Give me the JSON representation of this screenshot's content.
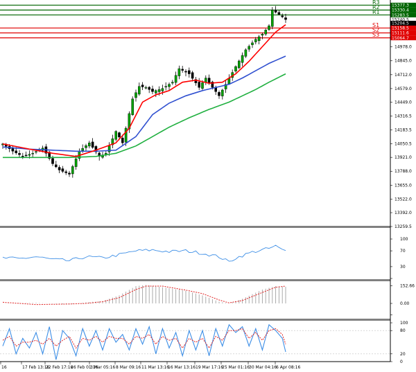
{
  "colors": {
    "background": "#ffffff",
    "axis": "#000000",
    "bull_candle": "#00a000",
    "bear_candle": "#000000",
    "ma_fast": "#ff0000",
    "ma_mid": "#3050d0",
    "ma_slow": "#20b040",
    "resistance": "#006400",
    "support": "#e00000",
    "rsi": "#3c8ee6",
    "macd_hist": "#a0a0a0",
    "macd_signal": "#e02020",
    "stoch_main": "#3c8ee6",
    "stoch_signal": "#e02020",
    "current_price_box": "#000000"
  },
  "chart_data": [
    {
      "type": "candlestick",
      "title": "",
      "ylim": [
        13259.5,
        15400
      ],
      "y_ticks": [
        "14978.0",
        "14845.0",
        "14712.0",
        "14579.0",
        "14449.0",
        "14316.5",
        "14183.5",
        "14050.5",
        "13921.0",
        "13788.0",
        "13655.0",
        "13522.0",
        "13392.0",
        "13259.5"
      ],
      "x_labels": [
        "16",
        "17 Feb 13:16",
        "22 Feb 17:16",
        "26 Feb 01:16",
        "3 Mar 05:16",
        "8 Mar 09:16",
        "11 Mar 13:16",
        "16 Mar 13:16",
        "19 Mar 17:16",
        "25 Mar 01:16",
        "30 Mar 04:16",
        "6 Apr 08:16"
      ],
      "levels": [
        {
          "name": "R3",
          "value": 15377.3,
          "label": "15377.3",
          "kind": "resistance"
        },
        {
          "name": "R2",
          "value": 15330.4,
          "label": "15330.4",
          "kind": "resistance"
        },
        {
          "name": "R1",
          "value": 15283.5,
          "label": "15283.5",
          "kind": "resistance"
        },
        {
          "name": "",
          "value": 15240.5,
          "label": "15240.5",
          "kind": "plain"
        },
        {
          "name": "",
          "value": 15204.5,
          "label": "15204.5",
          "kind": "current"
        },
        {
          "name": "S1",
          "value": 15158.5,
          "label": "15158.5",
          "kind": "support"
        },
        {
          "name": "S2",
          "value": 15111.6,
          "label": "15111.6",
          "kind": "support"
        },
        {
          "name": "S3",
          "value": 15064.7,
          "label": "15064.7",
          "kind": "support"
        }
      ],
      "close_anchors": [
        [
          0,
          14050
        ],
        [
          3,
          13980
        ],
        [
          6,
          13930
        ],
        [
          9,
          13960
        ],
        [
          12,
          14010
        ],
        [
          15,
          13860
        ],
        [
          17,
          13800
        ],
        [
          20,
          13760
        ],
        [
          23,
          13980
        ],
        [
          26,
          14060
        ],
        [
          29,
          13930
        ],
        [
          31,
          13960
        ],
        [
          34,
          14170
        ],
        [
          36,
          14060
        ],
        [
          39,
          14480
        ],
        [
          41,
          14600
        ],
        [
          43,
          14590
        ],
        [
          45,
          14550
        ],
        [
          48,
          14580
        ],
        [
          51,
          14640
        ],
        [
          53,
          14770
        ],
        [
          56,
          14720
        ],
        [
          59,
          14590
        ],
        [
          61,
          14680
        ],
        [
          63,
          14590
        ],
        [
          65,
          14510
        ],
        [
          67,
          14620
        ],
        [
          70,
          14790
        ],
        [
          73,
          14950
        ],
        [
          76,
          15050
        ],
        [
          78,
          15100
        ],
        [
          80,
          15180
        ],
        [
          81,
          15330
        ],
        [
          83,
          15290
        ],
        [
          85,
          15240
        ]
      ],
      "ma_fast_anchors": [
        [
          0,
          14050
        ],
        [
          8,
          14000
        ],
        [
          15,
          13960
        ],
        [
          22,
          13930
        ],
        [
          28,
          13990
        ],
        [
          34,
          14060
        ],
        [
          38,
          14200
        ],
        [
          42,
          14450
        ],
        [
          46,
          14520
        ],
        [
          50,
          14560
        ],
        [
          54,
          14640
        ],
        [
          58,
          14660
        ],
        [
          62,
          14630
        ],
        [
          66,
          14640
        ],
        [
          70,
          14720
        ],
        [
          74,
          14840
        ],
        [
          78,
          14980
        ],
        [
          82,
          15120
        ],
        [
          85,
          15190
        ]
      ],
      "ma_mid_anchors": [
        [
          0,
          14020
        ],
        [
          8,
          14000
        ],
        [
          15,
          13990
        ],
        [
          22,
          13980
        ],
        [
          28,
          13980
        ],
        [
          34,
          13990
        ],
        [
          40,
          14120
        ],
        [
          45,
          14330
        ],
        [
          50,
          14440
        ],
        [
          55,
          14510
        ],
        [
          60,
          14560
        ],
        [
          64,
          14590
        ],
        [
          68,
          14620
        ],
        [
          72,
          14680
        ],
        [
          76,
          14750
        ],
        [
          80,
          14820
        ],
        [
          85,
          14890
        ]
      ],
      "ma_slow_anchors": [
        [
          0,
          13920
        ],
        [
          10,
          13920
        ],
        [
          20,
          13920
        ],
        [
          28,
          13930
        ],
        [
          34,
          13960
        ],
        [
          40,
          14030
        ],
        [
          45,
          14120
        ],
        [
          50,
          14210
        ],
        [
          56,
          14300
        ],
        [
          62,
          14380
        ],
        [
          68,
          14450
        ],
        [
          72,
          14510
        ],
        [
          76,
          14570
        ],
        [
          80,
          14640
        ],
        [
          85,
          14720
        ]
      ]
    },
    {
      "type": "line",
      "title": "",
      "y_ticks": [
        "100",
        "70",
        "30",
        "0"
      ],
      "ylim": [
        0,
        100
      ],
      "rsi_anchors": [
        [
          0,
          52
        ],
        [
          5,
          50
        ],
        [
          10,
          55
        ],
        [
          15,
          48
        ],
        [
          20,
          45
        ],
        [
          25,
          55
        ],
        [
          30,
          52
        ],
        [
          35,
          60
        ],
        [
          40,
          70
        ],
        [
          45,
          72
        ],
        [
          50,
          68
        ],
        [
          55,
          70
        ],
        [
          60,
          64
        ],
        [
          65,
          55
        ],
        [
          68,
          42
        ],
        [
          70,
          52
        ],
        [
          75,
          67
        ],
        [
          80,
          76
        ],
        [
          82,
          82
        ],
        [
          84,
          72
        ],
        [
          85,
          70
        ]
      ]
    },
    {
      "type": "bar",
      "title": "",
      "y_ticks": [
        "152.66",
        "0.00",
        "-100"
      ],
      "ylim": [
        -120,
        180
      ],
      "hist_anchors": [
        [
          0,
          0
        ],
        [
          10,
          5
        ],
        [
          20,
          -10
        ],
        [
          25,
          10
        ],
        [
          30,
          20
        ],
        [
          35,
          70
        ],
        [
          40,
          150
        ],
        [
          43,
          160
        ],
        [
          48,
          140
        ],
        [
          55,
          110
        ],
        [
          60,
          70
        ],
        [
          65,
          15
        ],
        [
          68,
          0
        ],
        [
          72,
          40
        ],
        [
          78,
          120
        ],
        [
          82,
          150
        ],
        [
          85,
          145
        ]
      ],
      "signal_anchors": [
        [
          0,
          10
        ],
        [
          10,
          -10
        ],
        [
          20,
          -5
        ],
        [
          25,
          0
        ],
        [
          30,
          15
        ],
        [
          35,
          50
        ],
        [
          40,
          120
        ],
        [
          43,
          150
        ],
        [
          48,
          150
        ],
        [
          55,
          115
        ],
        [
          60,
          85
        ],
        [
          65,
          30
        ],
        [
          68,
          5
        ],
        [
          72,
          25
        ],
        [
          78,
          95
        ],
        [
          82,
          140
        ],
        [
          85,
          150
        ]
      ]
    },
    {
      "type": "line",
      "title": "",
      "y_ticks": [
        "100",
        "80",
        "20",
        "0"
      ],
      "ylim": [
        0,
        100
      ],
      "stoch_main_anchors": [
        [
          0,
          40
        ],
        [
          2,
          85
        ],
        [
          4,
          20
        ],
        [
          6,
          60
        ],
        [
          8,
          35
        ],
        [
          10,
          75
        ],
        [
          12,
          20
        ],
        [
          14,
          90
        ],
        [
          16,
          5
        ],
        [
          18,
          80
        ],
        [
          20,
          60
        ],
        [
          22,
          15
        ],
        [
          24,
          85
        ],
        [
          26,
          40
        ],
        [
          28,
          80
        ],
        [
          30,
          30
        ],
        [
          32,
          85
        ],
        [
          34,
          50
        ],
        [
          36,
          70
        ],
        [
          38,
          30
        ],
        [
          40,
          85
        ],
        [
          42,
          45
        ],
        [
          44,
          90
        ],
        [
          46,
          20
        ],
        [
          48,
          85
        ],
        [
          50,
          35
        ],
        [
          52,
          75
        ],
        [
          54,
          15
        ],
        [
          56,
          80
        ],
        [
          58,
          30
        ],
        [
          60,
          80
        ],
        [
          62,
          15
        ],
        [
          64,
          85
        ],
        [
          66,
          40
        ],
        [
          68,
          95
        ],
        [
          70,
          75
        ],
        [
          72,
          90
        ],
        [
          74,
          40
        ],
        [
          76,
          85
        ],
        [
          78,
          30
        ],
        [
          80,
          95
        ],
        [
          82,
          80
        ],
        [
          84,
          60
        ],
        [
          85,
          25
        ]
      ],
      "stoch_signal_anchors": [
        [
          0,
          55
        ],
        [
          2,
          65
        ],
        [
          4,
          40
        ],
        [
          6,
          50
        ],
        [
          8,
          50
        ],
        [
          10,
          55
        ],
        [
          12,
          45
        ],
        [
          14,
          60
        ],
        [
          16,
          40
        ],
        [
          18,
          55
        ],
        [
          20,
          65
        ],
        [
          22,
          35
        ],
        [
          24,
          60
        ],
        [
          26,
          55
        ],
        [
          28,
          65
        ],
        [
          30,
          50
        ],
        [
          32,
          65
        ],
        [
          34,
          60
        ],
        [
          36,
          60
        ],
        [
          38,
          45
        ],
        [
          40,
          65
        ],
        [
          42,
          60
        ],
        [
          44,
          70
        ],
        [
          46,
          45
        ],
        [
          48,
          65
        ],
        [
          50,
          55
        ],
        [
          52,
          60
        ],
        [
          54,
          35
        ],
        [
          56,
          60
        ],
        [
          58,
          50
        ],
        [
          60,
          60
        ],
        [
          62,
          35
        ],
        [
          64,
          65
        ],
        [
          66,
          55
        ],
        [
          68,
          80
        ],
        [
          70,
          80
        ],
        [
          72,
          85
        ],
        [
          74,
          60
        ],
        [
          76,
          75
        ],
        [
          78,
          55
        ],
        [
          80,
          80
        ],
        [
          82,
          85
        ],
        [
          84,
          70
        ],
        [
          85,
          45
        ]
      ]
    }
  ]
}
